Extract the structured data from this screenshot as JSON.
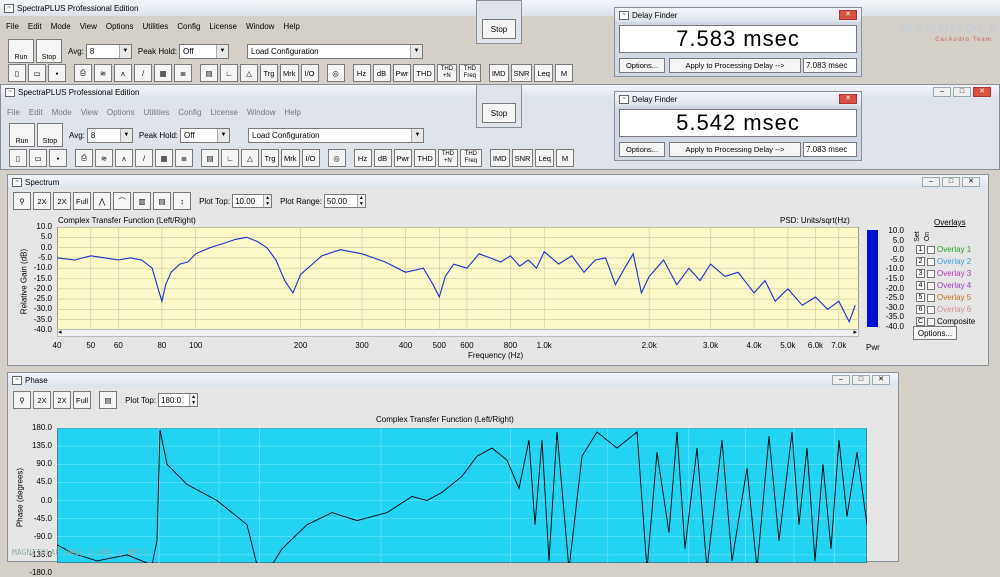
{
  "app": {
    "title1": "SpectraPLUS Professional Edition",
    "title2": "SpectraPLUS Professional Edition",
    "menu": [
      "File",
      "Edit",
      "Mode",
      "View",
      "Options",
      "Utilities",
      "Config",
      "License",
      "Window",
      "Help"
    ],
    "run_label": "Run",
    "stop_label": "Stop",
    "avg_label": "Avg:",
    "avg_value": "8",
    "peakhold_label": "Peak Hold:",
    "peakhold_value": "Off",
    "config_value": "Load Configuration",
    "tools": [
      "Hz",
      "dB",
      "Pwr",
      "THD",
      "THD +N",
      "THD Freq",
      "IMD",
      "SNR",
      "Leq",
      "M"
    ]
  },
  "stop_popup": {
    "label": "Stop"
  },
  "delay1": {
    "title": "Delay Finder",
    "value": "7.583 msec",
    "options": "Options...",
    "apply": "Apply to Processing Delay -->",
    "field": "7.083 msec"
  },
  "delay2": {
    "title": "Delay Finder",
    "value": "5.542 msec",
    "options": "Options...",
    "apply": "Apply to Processing Delay -->",
    "field": "7.083 msec"
  },
  "spectrum": {
    "title": "Spectrum",
    "plot_top_label": "Plot Top:",
    "plot_top": "10.00",
    "plot_range_label": "Plot Range:",
    "plot_range": "50.00",
    "chart_title": "Complex Transfer Function (Left/Right)",
    "psd": "PSD: Units/sqrt(Hz)",
    "ylabel": "Relative Gain (dB)",
    "xlabel": "Frequency (Hz)",
    "yticks": [
      "10.0",
      "5.0",
      "0.0",
      "-5.0",
      "-10.0",
      "-15.0",
      "-20.0",
      "-25.0",
      "-30.0",
      "-35.0",
      "-40.0"
    ],
    "xticks": [
      "40",
      "50",
      "60",
      "80",
      "100",
      "200",
      "300",
      "400",
      "500",
      "600",
      "800",
      "1.0k",
      "2.0k",
      "3.0k",
      "4.0k",
      "5.0k",
      "6.0k",
      "7.0k"
    ],
    "scale": [
      "10.0",
      "5.0",
      "0.0",
      "-5.0",
      "-10.0",
      "-15.0",
      "-20.0",
      "-25.0",
      "-30.0",
      "-35.0",
      "-40.0"
    ],
    "pwr": "Pwr",
    "overlays_title": "Overlays",
    "set_label": "Set",
    "on_label": "On",
    "overlays": [
      {
        "n": "1",
        "name": "Overlay 1",
        "color": "#2ca02c"
      },
      {
        "n": "2",
        "name": "Overlay 2",
        "color": "#3aa0d8"
      },
      {
        "n": "3",
        "name": "Overlay 3",
        "color": "#b03ab0"
      },
      {
        "n": "4",
        "name": "Overlay 4",
        "color": "#9a40c0"
      },
      {
        "n": "5",
        "name": "Overlay 5",
        "color": "#c07020"
      },
      {
        "n": "6",
        "name": "Overlay 6",
        "color": "#d09090"
      },
      {
        "n": "C",
        "name": "Composite",
        "color": "#000000"
      }
    ],
    "options": "Options..."
  },
  "phase": {
    "title": "Phase",
    "plot_top_label": "Plot Top:",
    "plot_top": "180.0",
    "chart_title": "Complex Transfer Function (Left/Right)",
    "ylabel": "Phase (degrees)",
    "yticks": [
      "180.0",
      "135.0",
      "90.0",
      "45.0",
      "0.0",
      "-45.0",
      "-90.0",
      "-135.0",
      "-180.0"
    ]
  },
  "colors": {
    "spectrum_bg": "#fbf9c8",
    "spectrum_line": "#1a2fd0",
    "phase_bg": "#22d3f2",
    "phase_line": "#000000"
  },
  "watermark_top": "MAGNITOLA CarAudio Team",
  "watermark_bottom": "MAGNITOLAE.ORG] [.RU] [.NET]",
  "chart_data": [
    {
      "type": "line",
      "title": "Complex Transfer Function (Left/Right)",
      "xlabel": "Frequency (Hz)",
      "ylabel": "Relative Gain (dB)",
      "xscale": "log",
      "xlim": [
        40,
        8000
      ],
      "ylim": [
        -40,
        10
      ],
      "x": [
        40,
        45,
        50,
        55,
        60,
        65,
        70,
        75,
        78,
        80,
        82,
        85,
        90,
        95,
        100,
        110,
        120,
        130,
        140,
        150,
        160,
        170,
        180,
        190,
        200,
        230,
        260,
        300,
        350,
        400,
        450,
        480,
        500,
        520,
        550,
        600,
        650,
        700,
        750,
        800,
        850,
        900,
        950,
        1000,
        1100,
        1200,
        1300,
        1400,
        1500,
        1600,
        1700,
        1800,
        1900,
        2000,
        2200,
        2400,
        2600,
        2800,
        3000,
        3300,
        3600,
        4000,
        4300,
        4600,
        5000,
        5500,
        6000,
        6500,
        7000,
        7500,
        7800
      ],
      "y": [
        -5,
        -6,
        -4,
        -5,
        -6,
        -5,
        -6,
        -10,
        -20,
        -26,
        -18,
        -12,
        -8,
        -7,
        -3,
        0,
        2,
        4,
        5,
        3,
        0,
        -6,
        -16,
        -22,
        -13,
        -4,
        -1,
        -3,
        -7,
        -12,
        -10,
        -18,
        -24,
        -14,
        -8,
        -10,
        -3,
        -5,
        -7,
        -4,
        -9,
        -6,
        -10,
        -2,
        -8,
        -4,
        -12,
        -6,
        -5,
        -18,
        -10,
        -3,
        -22,
        -14,
        -6,
        -18,
        -10,
        -16,
        -8,
        -14,
        -12,
        -22,
        -16,
        -26,
        -20,
        -28,
        -24,
        -30,
        -26,
        -36,
        -28
      ]
    },
    {
      "type": "line",
      "title": "Complex Transfer Function (Left/Right)",
      "ylabel": "Phase (degrees)",
      "xscale": "log",
      "ylim": [
        -180,
        180
      ]
    }
  ]
}
